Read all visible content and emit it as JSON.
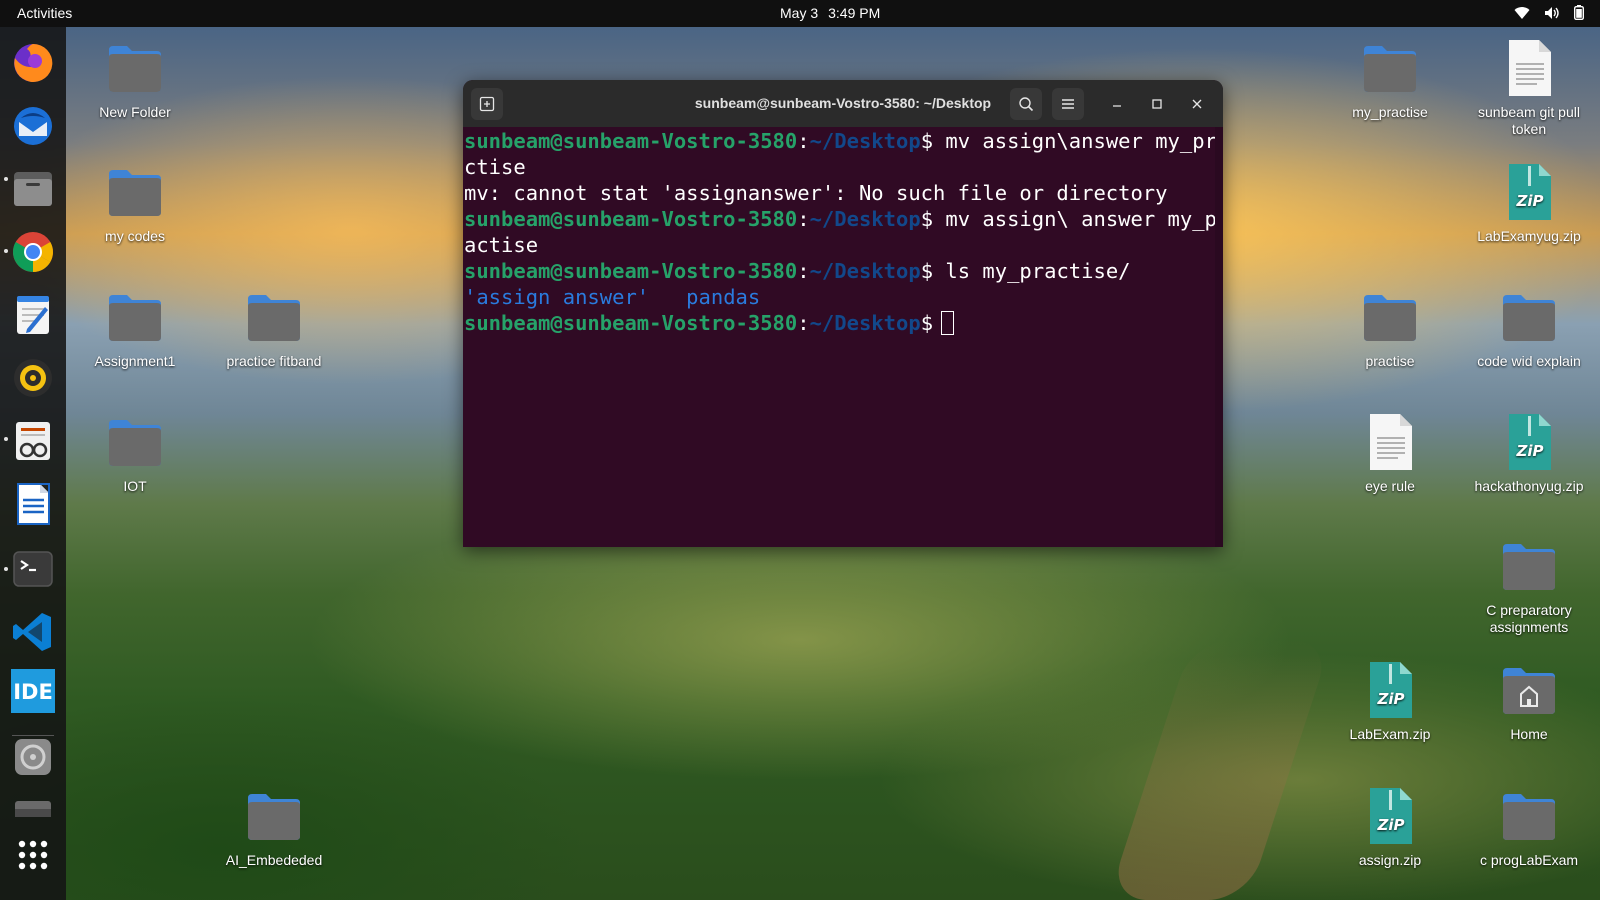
{
  "topbar": {
    "activities": "Activities",
    "date": "May 3",
    "time": "3:49 PM",
    "icons": [
      "wifi-icon",
      "volume-icon",
      "battery-icon"
    ]
  },
  "dock": {
    "apps": [
      "firefox",
      "thunderbird",
      "files",
      "chrome",
      "text-editor",
      "rhythmbox",
      "document-viewer",
      "libreoffice-writer",
      "terminal",
      "vscode",
      "ide",
      "disks",
      "drive",
      "show-apps"
    ]
  },
  "desktop": {
    "left": [
      {
        "label": "New Folder",
        "type": "folder"
      },
      {
        "label": "my codes",
        "type": "folder"
      },
      {
        "label": "Assignment1",
        "type": "folder"
      },
      {
        "label": "practice fitband",
        "type": "folder"
      },
      {
        "label": "IOT",
        "type": "folder"
      },
      {
        "label": "AI_Embededed",
        "type": "folder"
      }
    ],
    "right": [
      {
        "label": "my_practise",
        "type": "folder"
      },
      {
        "label": "sunbeam git pull token",
        "type": "text"
      },
      {
        "label": "LabExamyug.zip",
        "type": "zip"
      },
      {
        "label": "practise",
        "type": "folder"
      },
      {
        "label": "code wid explain",
        "type": "folder"
      },
      {
        "label": "eye rule",
        "type": "text"
      },
      {
        "label": "hackathonyug.zip",
        "type": "zip"
      },
      {
        "label": "C preparatory assignments",
        "type": "folder"
      },
      {
        "label": "LabExam.zip",
        "type": "zip"
      },
      {
        "label": "Home",
        "type": "home"
      },
      {
        "label": "assign.zip",
        "type": "zip"
      },
      {
        "label": "c progLabExam",
        "type": "folder"
      }
    ],
    "zip_badge": "ZiP"
  },
  "terminal": {
    "title": "sunbeam@sunbeam-Vostro-3580: ~/Desktop",
    "user": "sunbeam@sunbeam-Vostro-3580",
    "colon": ":",
    "path": "~/Desktop",
    "dollar": "$",
    "cmd1a": " mv assign\\answer my_pra",
    "cmd1b": "ctise",
    "err1": "mv: cannot stat 'assignanswer': No such file or directory",
    "cmd2a": " mv assign\\ answer my_pr",
    "cmd2b": "actise",
    "cmd3": " ls my_practise/",
    "ls1": "'assign answer'",
    "ls2": "pandas"
  }
}
